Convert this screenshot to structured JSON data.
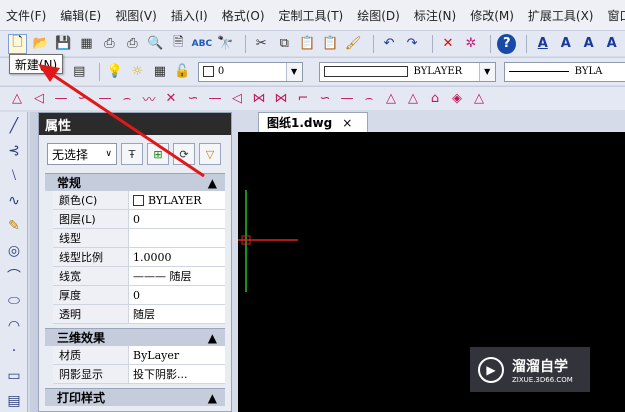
{
  "menu": [
    "文件(F)",
    "编辑(E)",
    "视图(V)",
    "插入(I)",
    "格式(O)",
    "定制工具(T)",
    "绘图(D)",
    "标注(N)",
    "修改(M)",
    "扩展工具(X)",
    "窗口"
  ],
  "toolbar_icons": [
    "new-file-icon",
    "open-folder-icon",
    "save-icon",
    "save-as-icon",
    "print-icon",
    "plot-icon",
    "print-preview-icon",
    "publish-icon",
    "spell-check-icon",
    "find-icon",
    "cut-icon",
    "copy-icon",
    "paste-icon",
    "paste-special-icon",
    "match-properties-icon",
    "undo-icon",
    "redo-icon",
    "delete-icon",
    "purge-icon",
    "help-icon",
    "text-style-icon",
    "text-icon",
    "text-edit-icon",
    "text-find-icon"
  ],
  "tooltip": "新建(N)",
  "layer": {
    "value": "0"
  },
  "color": {
    "value": "BYLAYER"
  },
  "linetype": {
    "value": "BYLA"
  },
  "properties": {
    "title": "属性",
    "selection": "无选择",
    "sections": [
      {
        "name": "常规",
        "rows": [
          {
            "key": "颜色(C)",
            "value": "BYLAYER"
          },
          {
            "key": "图层(L)",
            "value": "0"
          },
          {
            "key": "线型",
            "value": ""
          },
          {
            "key": "线型比例",
            "value": "1.0000"
          },
          {
            "key": "线宽",
            "value": "——— 随层"
          },
          {
            "key": "厚度",
            "value": "0"
          },
          {
            "key": "透明",
            "value": "随层"
          }
        ]
      },
      {
        "name": "三维效果",
        "rows": [
          {
            "key": "材质",
            "value": "ByLayer"
          },
          {
            "key": "阴影显示",
            "value": "投下阴影..."
          }
        ]
      },
      {
        "name": "打印样式",
        "rows": []
      }
    ]
  },
  "tab": {
    "label": "图纸1.dwg",
    "close": "×"
  },
  "watermark": {
    "main": "溜溜自学",
    "sub": "ZIXUE.3D66.COM"
  }
}
